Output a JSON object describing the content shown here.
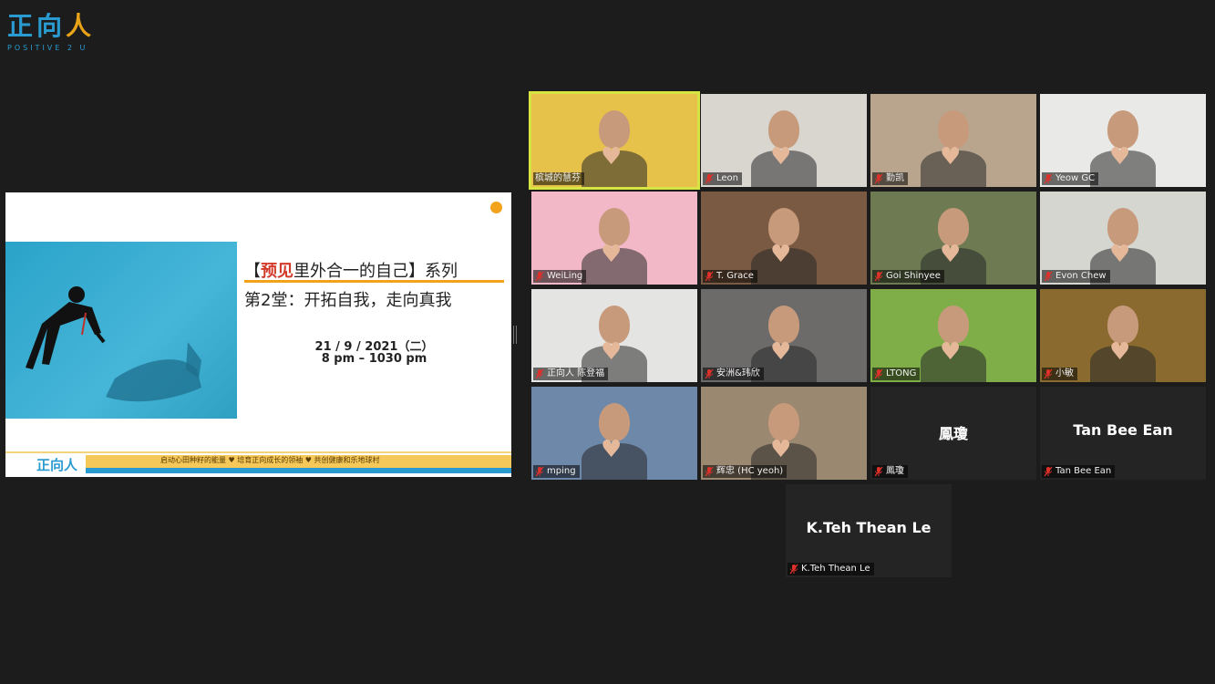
{
  "logo": {
    "cn_main": "正向",
    "cn_ren": "人",
    "en": "POSITIVE 2 U"
  },
  "slide": {
    "title_open": "【",
    "title_highlight": "预见",
    "title_rest": "里外合一的自己】系列",
    "title2": "第2堂：开拓自我，走向真我",
    "date": "21 / 9 / 2021（二）",
    "time": "8 pm – 1030 pm",
    "footer_logo": "正向人",
    "footer_text": "启动心田种籽的能量 ♥ 培育正向成长的领袖 ♥ 共创健康和乐地球村"
  },
  "participants": [
    {
      "name": "槟城的慧芬",
      "muted": false,
      "active": true,
      "bg": "#e6c24a"
    },
    {
      "name": "Leon",
      "muted": true,
      "active": false,
      "bg": "#d9d6d0"
    },
    {
      "name": "勤凯",
      "muted": true,
      "active": false,
      "bg": "#b9a58e"
    },
    {
      "name": "Yeow GC",
      "muted": true,
      "active": false,
      "bg": "#e9e9e7"
    },
    {
      "name": "WeiLing",
      "muted": true,
      "active": false,
      "bg": "#f2b8c8"
    },
    {
      "name": "T. Grace",
      "muted": true,
      "active": false,
      "bg": "#7a5a42"
    },
    {
      "name": "Goi Shinyee",
      "muted": true,
      "active": false,
      "bg": "#6e7a52"
    },
    {
      "name": "Evon Chew",
      "muted": true,
      "active": false,
      "bg": "#d6d6d0"
    },
    {
      "name": "正向人 陈登福",
      "muted": true,
      "active": false,
      "bg": "#e4e4e2"
    },
    {
      "name": "安洲&玮欣",
      "muted": true,
      "active": false,
      "bg": "#6d6b6a"
    },
    {
      "name": "LTONG",
      "muted": true,
      "active": false,
      "bg": "#7fae48"
    },
    {
      "name": "小敏",
      "muted": true,
      "active": false,
      "bg": "#8a6a2e"
    },
    {
      "name": "mping",
      "muted": true,
      "active": false,
      "bg": "#6d88a8"
    },
    {
      "name": "辉忠 (HC yeoh)",
      "muted": true,
      "active": false,
      "bg": "#9a8870"
    },
    {
      "name": "鳳瓊",
      "muted": true,
      "active": false,
      "bg": "#242424",
      "center_label": "鳳瓊"
    },
    {
      "name": "Tan Bee Ean",
      "muted": true,
      "active": false,
      "bg": "#242424",
      "center_label": "Tan Bee Ean"
    },
    {
      "name": "K.Teh Thean Le",
      "muted": true,
      "active": false,
      "bg": "#242424",
      "center_label": "K.Teh Thean Le"
    }
  ],
  "colors": {
    "accent": "#2a9bd0",
    "active_border": "#d7e542",
    "muted_icon": "#e0302a"
  }
}
